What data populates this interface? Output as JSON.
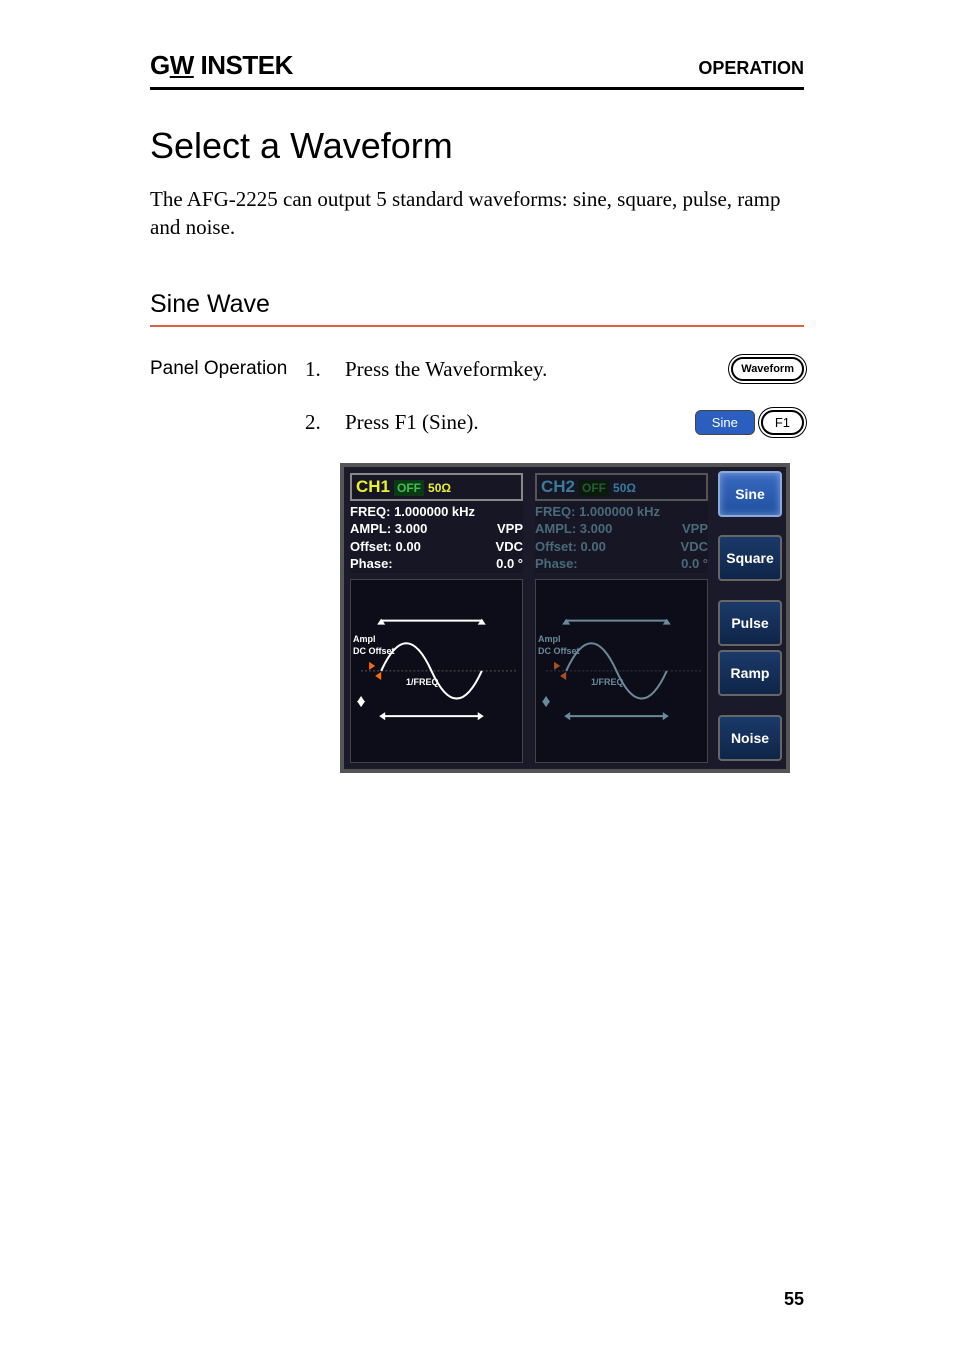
{
  "header": {
    "brand": "GW INSTEK",
    "section": "OPERATION"
  },
  "title": "Select a Waveform",
  "intro": "The AFG-2225 can output 5 standard waveforms: sine, square, pulse, ramp and noise.",
  "subsection": "Sine Wave",
  "panel_op_label": "Panel Operation",
  "steps": [
    {
      "n": "1.",
      "text": "Press the Waveformkey.",
      "key": "Waveform"
    },
    {
      "n": "2.",
      "text": "Press F1 (Sine).",
      "soft": "Sine",
      "fkey": "F1"
    }
  ],
  "screen": {
    "ch1": {
      "name": "CH1",
      "state": "OFF",
      "imp": "50Ω",
      "freq_label": "FREQ:",
      "freq": "1.000000 kHz",
      "ampl_label": "AMPL:",
      "ampl": "3.000",
      "ampl_unit": "VPP",
      "off_label": "Offset:",
      "off": "0.00",
      "off_unit": "VDC",
      "phase_label": "Phase:",
      "phase": "0.0 °"
    },
    "ch2": {
      "name": "CH2",
      "state": "OFF",
      "imp": "50Ω",
      "freq_label": "FREQ:",
      "freq": "1.000000 kHz",
      "ampl_label": "AMPL:",
      "ampl": "3.000",
      "ampl_unit": "VPP",
      "off_label": "Offset:",
      "off": "0.00",
      "off_unit": "VDC",
      "phase_label": "Phase:",
      "phase": "0.0 °"
    },
    "diagram": {
      "ampl": "Ampl",
      "dcoff": "DC Offset",
      "freq": "1/FREQ"
    },
    "buttons": [
      "Sine",
      "Square",
      "Pulse",
      "Ramp",
      "Noise"
    ]
  },
  "page_number": "55"
}
